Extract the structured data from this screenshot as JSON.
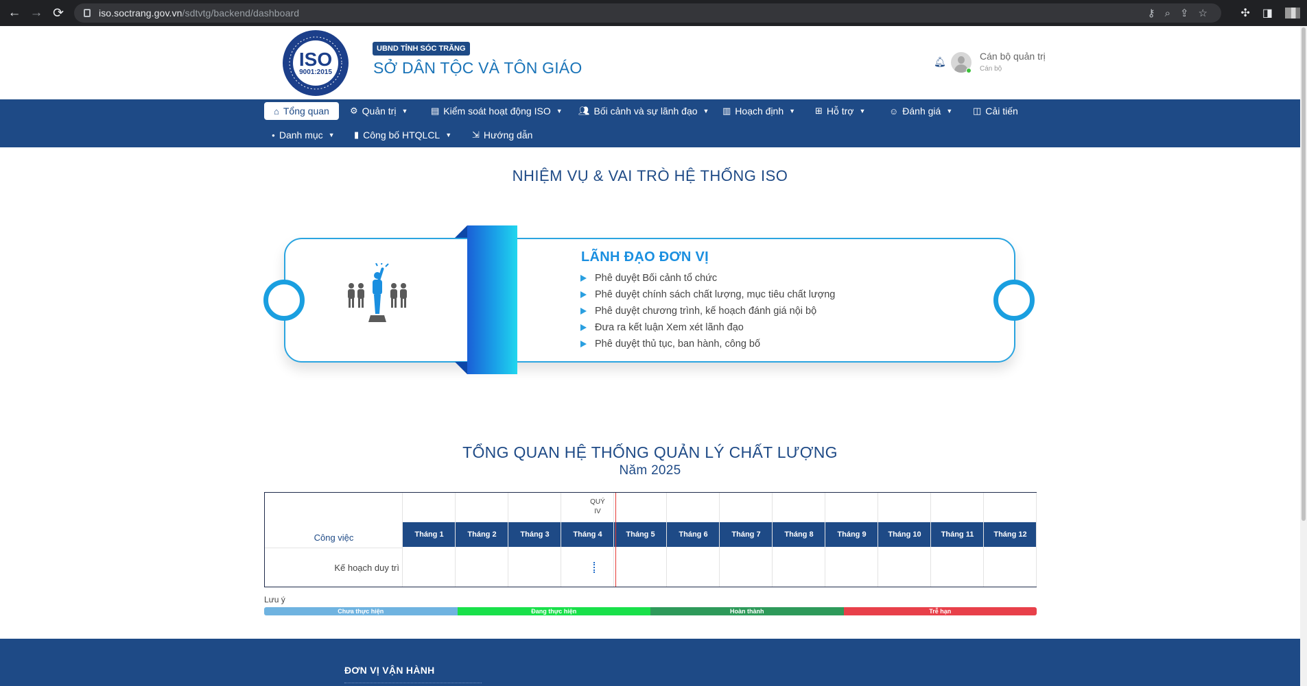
{
  "browser": {
    "url_host": "iso.soctrang.gov.vn",
    "url_path": "/sdtvtg/backend/dashboard"
  },
  "header": {
    "logo_text": "ISO",
    "logo_standard": "9001:2015",
    "badge": "UBND TỈNH SÓC TRĂNG",
    "title": "SỞ DÂN TỘC VÀ TÔN GIÁO",
    "user_name": "Cán bộ quản trị",
    "user_role": "Cán bộ"
  },
  "nav": {
    "items": [
      {
        "label": "Tổng quan",
        "icon": "home-icon"
      },
      {
        "label": "Quản trị",
        "icon": "gear-icon"
      },
      {
        "label": "Kiểm soát hoạt động ISO",
        "icon": "document-icon"
      },
      {
        "label": "Bối cảnh và sự lãnh đạo",
        "icon": "users-icon"
      },
      {
        "label": "Hoạch định",
        "icon": "chart-icon"
      },
      {
        "label": "Hỗ trợ",
        "icon": "support-icon"
      },
      {
        "label": "Đánh giá",
        "icon": "user-check-icon"
      },
      {
        "label": "Cải tiến",
        "icon": "improve-icon"
      },
      {
        "label": "Danh mục",
        "icon": "dot-icon"
      },
      {
        "label": "Công bố HTQLCL",
        "icon": "bookmark-icon"
      },
      {
        "label": "Hướng dẫn",
        "icon": "guide-icon"
      }
    ]
  },
  "roles": {
    "section_title": "NHIỆM VỤ & VAI TRÒ HỆ THỐNG ISO",
    "heading": "LÃNH ĐẠO ĐƠN VỊ",
    "items": [
      "Phê duyệt Bối cảnh tổ chức",
      "Phê duyệt chính sách chất lượng, mục tiêu chất lượng",
      "Phê duyệt chương trình, kế hoạch đánh giá nội bộ",
      "Đưa ra kết luận Xem xét lãnh đạo",
      "Phê duyệt thủ tục, ban hành, công bố"
    ]
  },
  "overview": {
    "title": "TỔNG QUAN HỆ THỐNG QUẢN LÝ CHẤT LƯỢNG",
    "year": "Năm 2025",
    "work_header": "Công việc",
    "quarter_label_line1": "QUÝ",
    "quarter_label_line2": "IV",
    "months": [
      "Tháng 1",
      "Tháng 2",
      "Tháng 3",
      "Tháng 4",
      "Tháng 5",
      "Tháng 6",
      "Tháng 7",
      "Tháng 8",
      "Tháng 9",
      "Tháng 10",
      "Tháng 11",
      "Tháng 12"
    ],
    "row_label": "Kế hoạch duy trì",
    "legend_title": "Lưu ý",
    "legend": [
      {
        "label": "Chưa thực hiện",
        "color": "#6fb3e0"
      },
      {
        "label": "Đang thực hiện",
        "color": "#19e04a"
      },
      {
        "label": "Hoàn thành",
        "color": "#2e9a5a"
      },
      {
        "label": "Trễ hạn",
        "color": "#e8404a"
      }
    ]
  },
  "footer": {
    "title": "ĐƠN VỊ VẬN HÀNH"
  }
}
